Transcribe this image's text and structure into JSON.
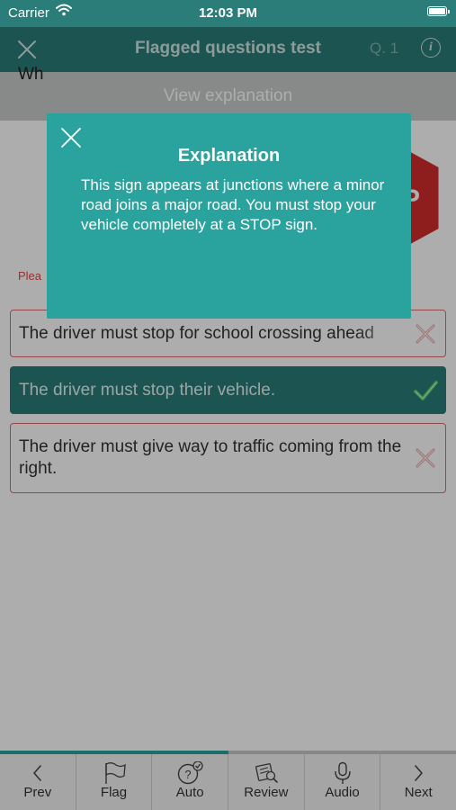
{
  "status_bar": {
    "carrier": "Carrier",
    "time": "12:03 PM"
  },
  "nav": {
    "title": "Flagged questions test",
    "question_number": "Q. 1",
    "info_label": "i"
  },
  "explanation_bar": {
    "label": "View explanation"
  },
  "question": {
    "text_visible": "Wh",
    "hint_visible": "Plea"
  },
  "answers": [
    {
      "text": "The driver must stop for school crossing ahead",
      "state": "wrong"
    },
    {
      "text": "The driver must stop their vehicle.",
      "state": "correct"
    },
    {
      "text": "The driver must give way to traffic coming from the right.",
      "state": "wrong"
    }
  ],
  "modal": {
    "title": "Explanation",
    "body": "This sign appears at junctions where a minor road joins a major road. You must stop your vehicle completely at a STOP sign."
  },
  "progress": {
    "fraction": 0.5
  },
  "tabs": [
    {
      "label": "Prev",
      "icon": "chevron-left-icon"
    },
    {
      "label": "Flag",
      "icon": "flag-icon"
    },
    {
      "label": "Auto",
      "icon": "auto-question-icon"
    },
    {
      "label": "Review",
      "icon": "review-icon"
    },
    {
      "label": "Audio",
      "icon": "microphone-icon"
    },
    {
      "label": "Next",
      "icon": "chevron-right-icon"
    }
  ],
  "colors": {
    "primary": "#2a7d78",
    "modal": "#2aa39e",
    "wrong": "#e06a6a",
    "correct_mark": "#2fb34a"
  }
}
